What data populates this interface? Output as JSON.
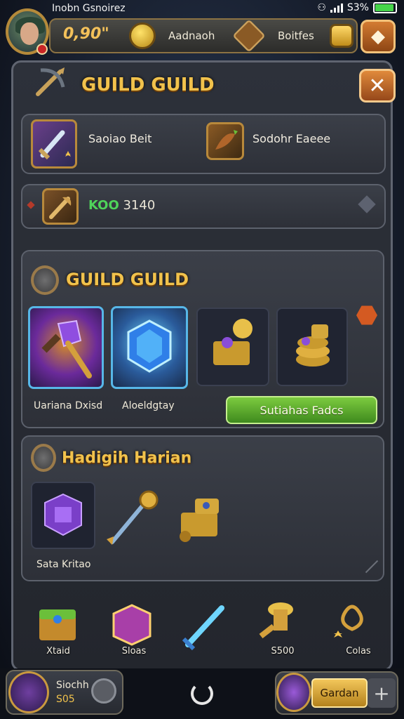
{
  "status_bar": {
    "title": "Inobn Gsnoirez",
    "battery_text": "S3%",
    "battery_level": 0.93
  },
  "hud": {
    "value": "0,90\"",
    "label_1": "Aadnaoh",
    "label_2": "Boitfes"
  },
  "main": {
    "title": "GUILD GUILD"
  },
  "stats": {
    "item_1": "Saoiao Beit",
    "item_2": "Sodohr Eaeee"
  },
  "currency": {
    "code": "KOO",
    "value": "3140"
  },
  "guild_panel": {
    "title": "GUILD GUILD",
    "slot_labels": [
      "Uariana Dxisd",
      "Aloeldgtay"
    ],
    "button_label": "Sutiahas Fadcs"
  },
  "hadigh_panel": {
    "title": "Hadigih Harian",
    "item_label": "Sata Kritao"
  },
  "bottom_nav": {
    "items": [
      "Xtaid",
      "Sloas",
      "",
      "S500",
      "Colas"
    ]
  },
  "bottom_bar": {
    "player_name": "Siochh",
    "player_value": "S05",
    "action_button": "Gardan",
    "plus": "+"
  },
  "colors": {
    "accent_gold": "#f1c24c",
    "close_orange": "#d37b32",
    "button_green": "#7ccb3f",
    "slot_highlight": "#57b7e8",
    "currency_green": "#4fd35a"
  },
  "icons": {
    "close": "close-icon",
    "menu": "diamond-menu-icon",
    "refresh": "refresh-icon"
  }
}
